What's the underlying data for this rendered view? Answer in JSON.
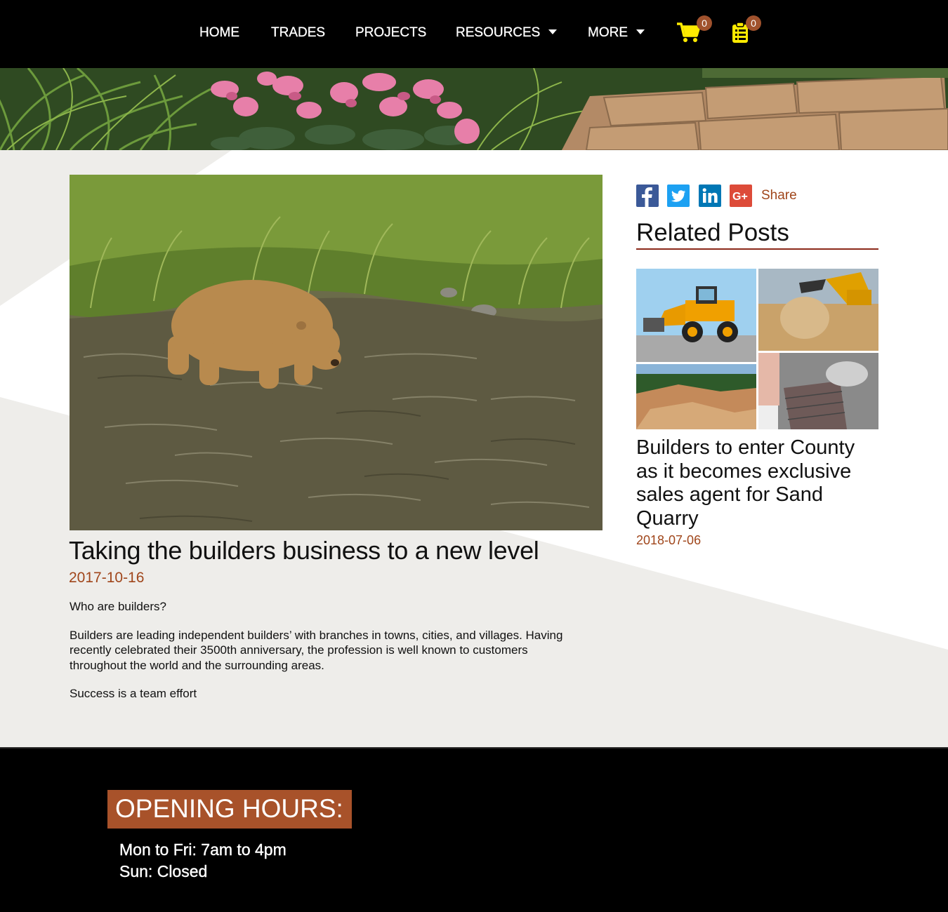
{
  "nav": {
    "items": [
      {
        "label": "HOME"
      },
      {
        "label": "TRADES"
      },
      {
        "label": "PROJECTS"
      },
      {
        "label": "RESOURCES",
        "dropdown": true
      },
      {
        "label": "MORE",
        "dropdown": true
      }
    ],
    "cart_count": "0",
    "quote_count": "0",
    "icon_color": "#ffeb00",
    "badge_color": "#a0522d"
  },
  "post": {
    "title": "Taking the builders business to a new level",
    "date": "2017-10-16",
    "paragraphs": [
      "Who are builders?",
      "Builders are leading independent builders’ with branches in towns, cities, and villages. Having recently celebrated their 3500th anniversary, the profession is well known to customers throughout the world and the surrounding areas.",
      "Success is a team effort"
    ],
    "image_icon": "bear-in-river-photo"
  },
  "share": {
    "label": "Share",
    "icons": [
      "facebook-icon",
      "twitter-icon",
      "linkedin-icon",
      "google-plus-icon"
    ]
  },
  "related": {
    "heading": "Related Posts",
    "posts": [
      {
        "title": "Builders to enter County as it becomes exclusive sales agent for Sand Quarry",
        "date": "2018-07-06"
      }
    ]
  },
  "footer": {
    "heading": "OPENING HOURS:",
    "lines": [
      "Mon to Fri: 7am to 4pm",
      "Sun: Closed"
    ]
  },
  "colors": {
    "accent": "#a0461b",
    "footer_heading_bg": "#a8522a",
    "nav_bg": "#000000"
  }
}
